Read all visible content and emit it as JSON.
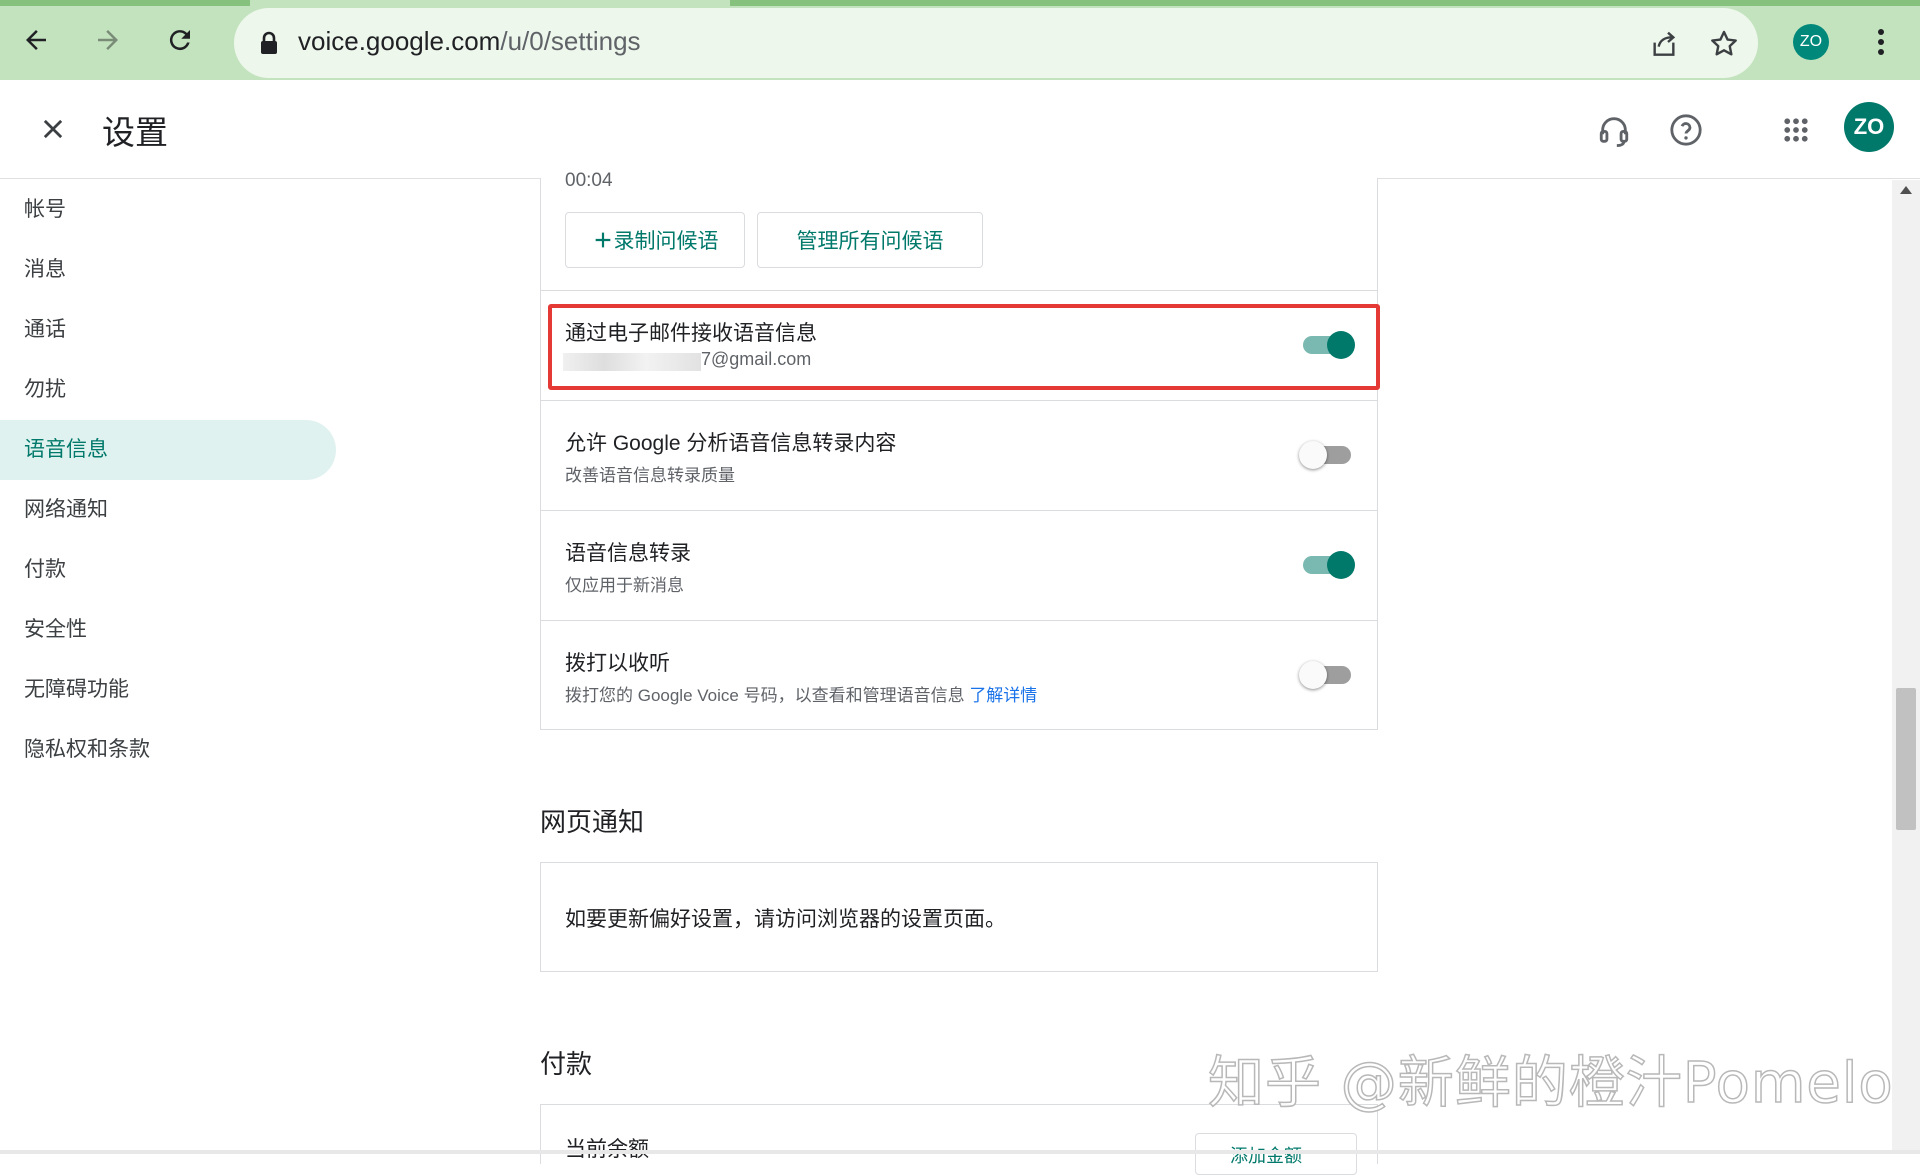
{
  "browser": {
    "url_domain": "voice.google.com",
    "url_path": "/u/0/settings",
    "avatar_initials": "ZO",
    "icons": [
      "back-arrow-icon",
      "forward-arrow-icon",
      "reload-icon",
      "lock-icon",
      "share-icon",
      "star-icon",
      "more-vert-icon"
    ]
  },
  "header": {
    "title": "设置",
    "avatar_initials": "ZO",
    "icons": [
      "close-icon",
      "headset-icon",
      "help-icon",
      "apps-grid-icon"
    ]
  },
  "sidebar": {
    "items": [
      {
        "label": "帐号"
      },
      {
        "label": "消息"
      },
      {
        "label": "通话"
      },
      {
        "label": "勿扰"
      },
      {
        "label": "语音信息",
        "active": true
      },
      {
        "label": "网络通知"
      },
      {
        "label": "付款"
      },
      {
        "label": "安全性"
      },
      {
        "label": "无障碍功能"
      },
      {
        "label": "隐私权和条款"
      }
    ]
  },
  "voicemail": {
    "greeting_duration": "00:04",
    "record_button": "录制问候语",
    "manage_button": "管理所有问候语",
    "rows": [
      {
        "title": "通过电子邮件接收语音信息",
        "email_visible": "7@gmail.com",
        "enabled": true,
        "highlighted": true
      },
      {
        "title": "允许 Google 分析语音信息转录内容",
        "subtitle": "改善语音信息转录质量",
        "enabled": false
      },
      {
        "title": "语音信息转录",
        "subtitle": "仅应用于新消息",
        "enabled": true
      },
      {
        "title": "拨打以收听",
        "subtitle": "拨打您的 Google Voice 号码，以查看和管理语音信息",
        "link": "了解详情",
        "enabled": false
      }
    ]
  },
  "web_notifications": {
    "heading": "网页通知",
    "text": "如要更新偏好设置，请访问浏览器的设置页面。"
  },
  "payments": {
    "heading": "付款",
    "balance_label": "当前余额",
    "button_label": "添加金额"
  },
  "watermark": "知乎 @新鲜的橙汁Pomelo",
  "colors": {
    "accent": "#00796b",
    "active_bg": "#e0f2ef",
    "link": "#1a73e8",
    "highlight_border": "#e53935",
    "chrome_bg": "#c3e3be"
  }
}
